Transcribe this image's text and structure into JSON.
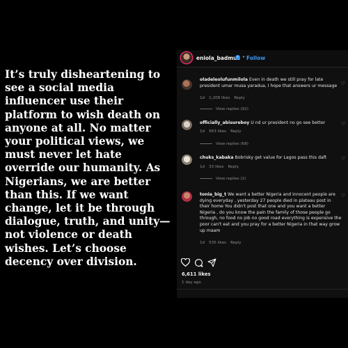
{
  "quote": "It’s truly disheartening to see a social media influencer use their platform to wish death on anyone at all. No matter your political views, we must never let hate override our humanity. As Nigerians, we are better than this. If we want change, let it be through dialogue, truth, and unity—not violence or death wishes. Let’s choose decency over division.",
  "post": {
    "username": "eniola_badmus",
    "separator": "•",
    "follow_label": "Follow",
    "likes": "6,611 likes",
    "time_ago": "1 day ago"
  },
  "comments": [
    {
      "username": "oladeleolufunmilola",
      "text": "Even in death we still pray for late president umar musa yaradua, I hope that answers ur message",
      "time": "1d",
      "likes": "1,208 likes",
      "reply_label": "Reply",
      "view_replies": "View replies (92)"
    },
    {
      "username": "officially_abisureboy",
      "text": "U nd ur president no go see better",
      "time": "1d",
      "likes": "563 likes",
      "reply_label": "Reply",
      "view_replies": "View replies (68)"
    },
    {
      "username": "chuks_kabaka",
      "text": "Bobrisky get value for Lagos pass this daft",
      "time": "1d",
      "likes": "33 likes",
      "reply_label": "Reply",
      "view_replies": "View replies (2)"
    },
    {
      "username": "tonia_big_t",
      "text": "We want a better Nigeria and innocent people are dying everyday , yesterday 27 people died in plateau post in their home You didn't post that one and you want a better Nigeria , do you know the pain the family of those people go through, no food no job no good road everything is expensive the poor can't eat and you pray for a better Nigeria in that way grow up maam",
      "time": "1d",
      "likes": "535 likes",
      "reply_label": "Reply"
    }
  ],
  "colors": {
    "background": "#000000",
    "panel": "#101010",
    "link_blue": "#3897f0",
    "muted": "#8e8e8e"
  },
  "icons": [
    "verified-badge-icon",
    "heart-icon",
    "comment-icon",
    "share-icon"
  ]
}
